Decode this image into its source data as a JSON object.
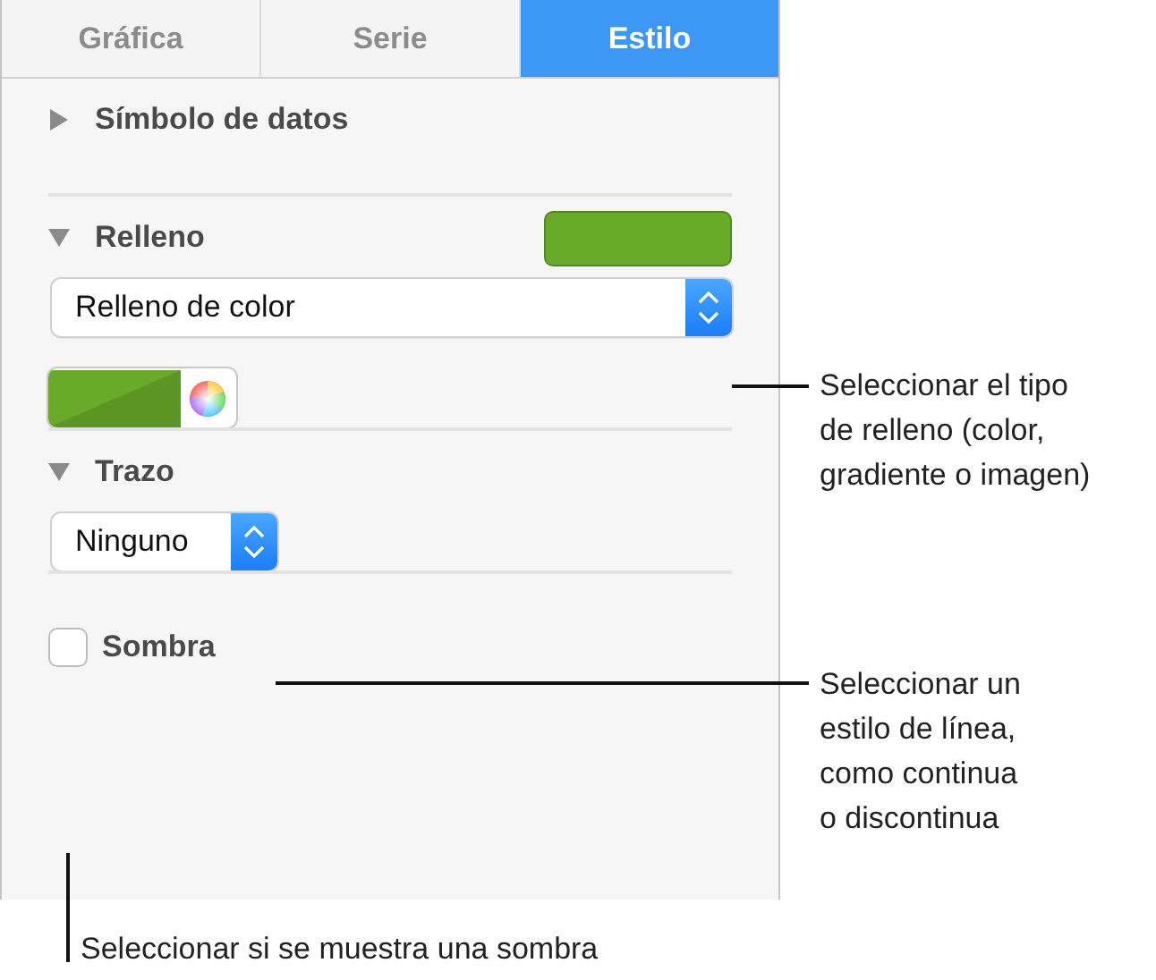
{
  "tabs": [
    {
      "label": "Gráfica",
      "selected": false
    },
    {
      "label": "Serie",
      "selected": false
    },
    {
      "label": "Estilo",
      "selected": true
    }
  ],
  "sections": [
    {
      "kind": "disclosure",
      "title": "Símbolo de datos",
      "expanded": false
    },
    {
      "kind": "fill",
      "title": "Relleno",
      "expanded": true,
      "color": "#6aaa2a",
      "popup": "Relleno de color"
    },
    {
      "kind": "stroke",
      "title": "Trazo",
      "expanded": true,
      "popup": "Ninguno"
    },
    {
      "kind": "checkbox",
      "title": "Sombra",
      "checked": false
    }
  ],
  "callouts": [
    {
      "lines": [
        "Seleccionar el tipo",
        "de relleno (color,",
        "gradiente o imagen)"
      ]
    },
    {
      "lines": [
        "Seleccionar un",
        "estilo de línea,",
        "como continua",
        "o discontinua"
      ]
    },
    {
      "lines": [
        "Seleccionar si se muestra una sombra"
      ]
    }
  ]
}
